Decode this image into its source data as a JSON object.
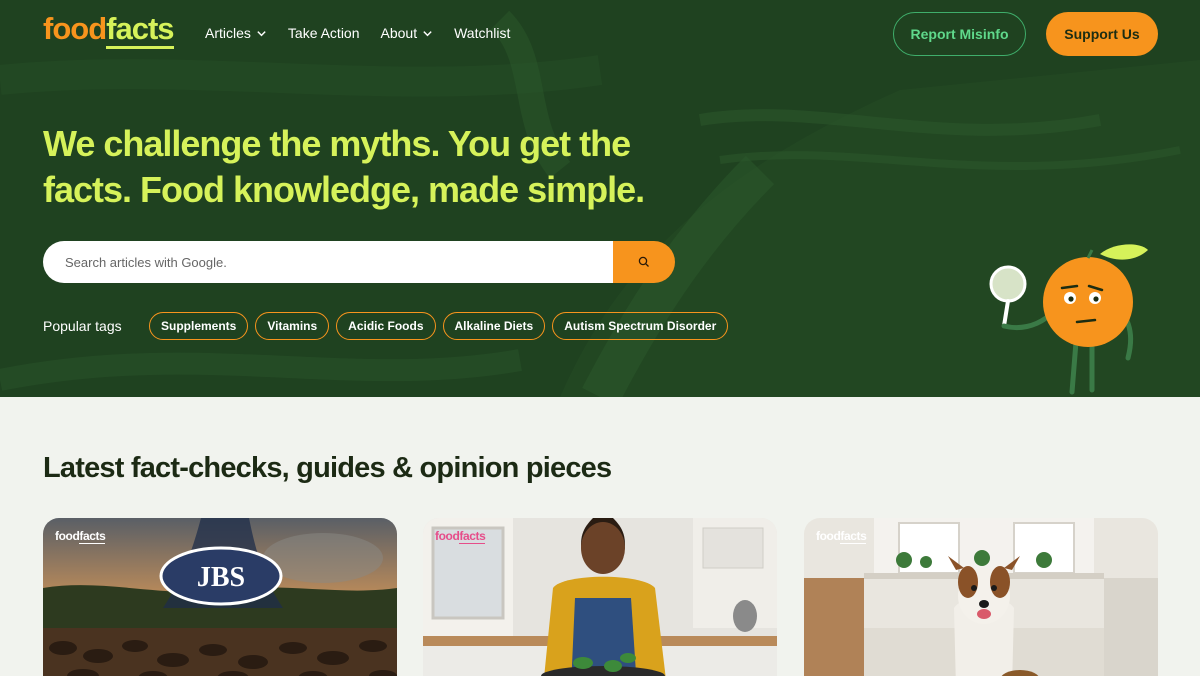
{
  "brand": {
    "logo_food": "food",
    "logo_facts": "facts",
    "accent": "#f7941d",
    "lime": "#d6f25a",
    "hero_bg": "#1f4220"
  },
  "nav": {
    "items": [
      {
        "label": "Articles",
        "has_dropdown": true
      },
      {
        "label": "Take Action",
        "has_dropdown": false
      },
      {
        "label": "About",
        "has_dropdown": true
      },
      {
        "label": "Watchlist",
        "has_dropdown": false
      }
    ],
    "report_label": "Report Misinfo",
    "support_label": "Support Us"
  },
  "hero": {
    "headline": "We challenge the myths. You get the facts. Food knowledge, made simple.",
    "search": {
      "placeholder": "Search articles with Google.",
      "icon": "search-icon"
    },
    "tags_label": "Popular tags",
    "tags": [
      "Supplements",
      "Vitamins",
      "Acidic Foods",
      "Alkaline Diets",
      "Autism Spectrum Disorder"
    ]
  },
  "latest": {
    "title": "Latest fact-checks, guides & opinion pieces",
    "cards": [
      {
        "logo_food": "food",
        "logo_facts": "facts",
        "image_text": "JBS"
      },
      {
        "logo_food": "food",
        "logo_facts": "facts"
      },
      {
        "logo_food": "food",
        "logo_facts": "facts"
      }
    ]
  }
}
